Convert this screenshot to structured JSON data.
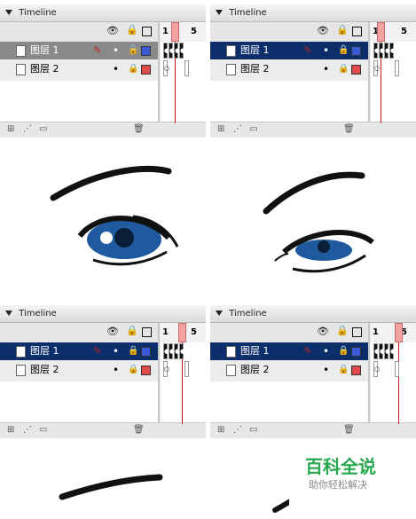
{
  "timeline": {
    "title": "Timeline",
    "frame_numbers": [
      "1",
      "5"
    ],
    "layers": [
      {
        "name": "图层 1",
        "color": "#3b5bd6"
      },
      {
        "name": "图层 2",
        "color": "#e04a4a"
      }
    ]
  },
  "panels": [
    {
      "id": "top-left",
      "selected_layer": 0,
      "selected_style": "gray"
    },
    {
      "id": "top-right",
      "selected_layer": 0,
      "selected_style": "blue"
    },
    {
      "id": "bottom-left",
      "selected_layer": 0,
      "selected_style": "blue"
    },
    {
      "id": "bottom-right",
      "selected_layer": 0,
      "selected_style": "blue"
    }
  ],
  "watermark": {
    "title": "百科全说",
    "subtitle": "助你轻松解决"
  },
  "colors": {
    "selection": "#0c2e6b",
    "playhead": "#c41f1f",
    "eye_iris": "#1f5a9e",
    "brand_green": "#27a84f"
  }
}
